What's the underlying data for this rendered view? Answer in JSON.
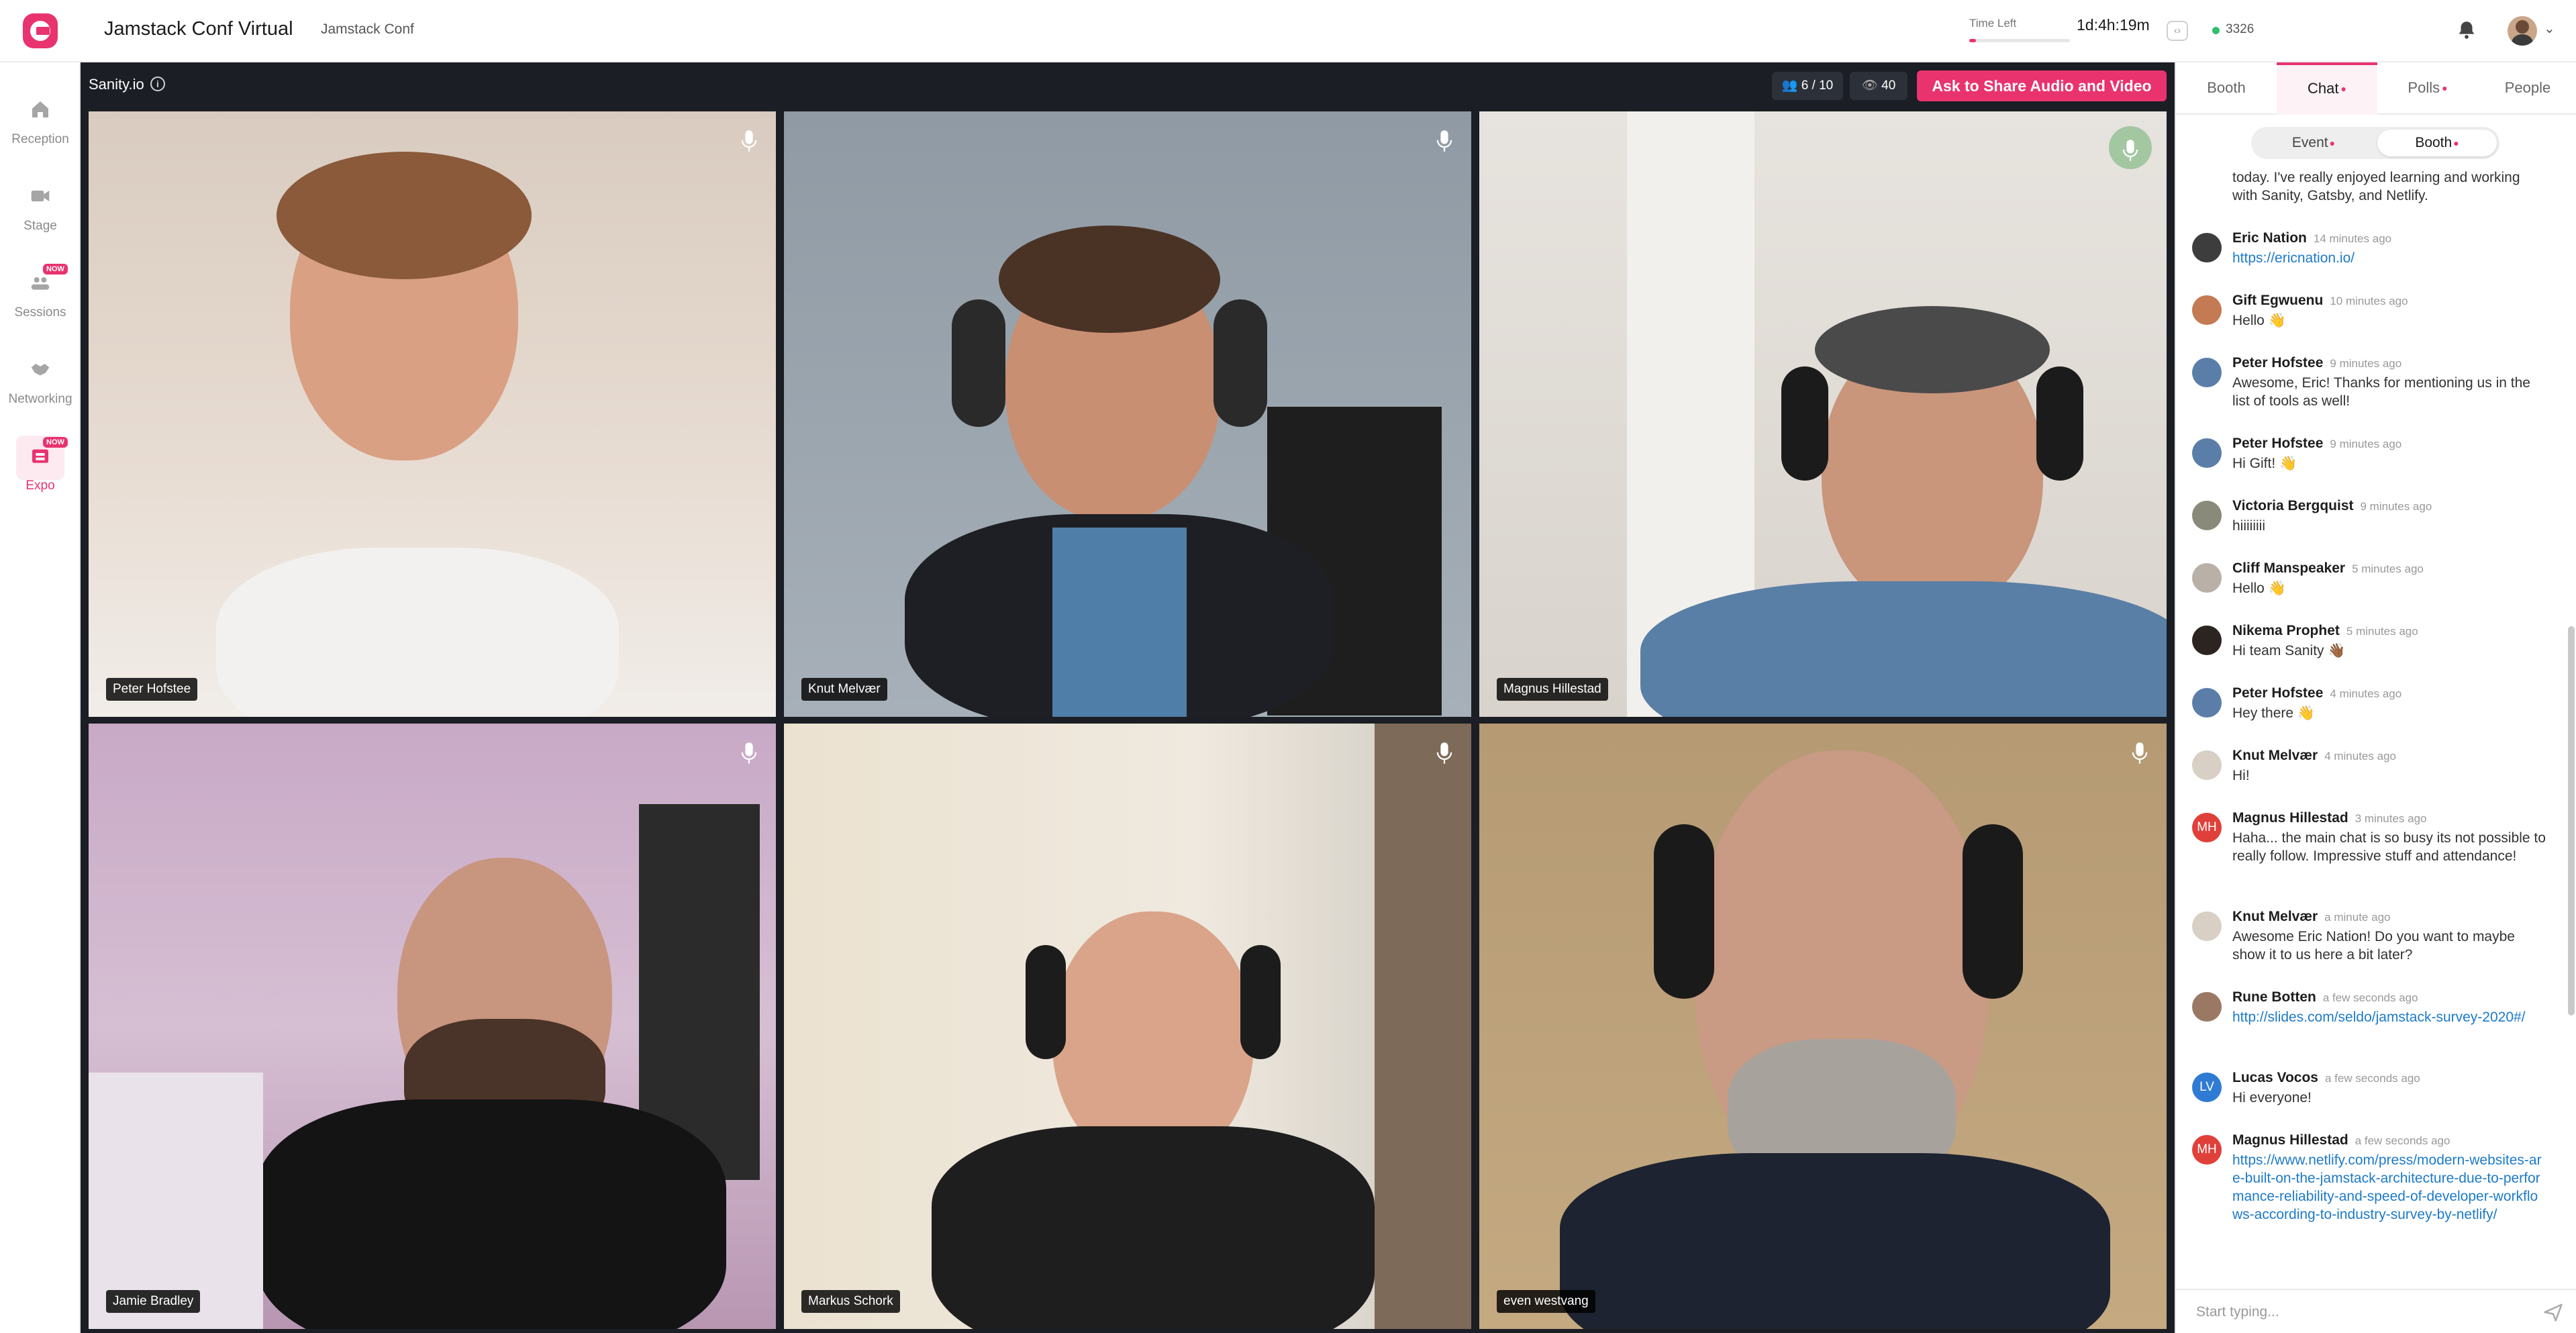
{
  "header": {
    "app_title": "Jamstack Conf Virtual",
    "org_name": "Jamstack Conf",
    "time_left_label": "Time Left",
    "time_left_value": "1d:4h:19m",
    "online_count": "3326"
  },
  "sidebar": {
    "items": [
      {
        "label": "Reception",
        "icon": "home-icon"
      },
      {
        "label": "Stage",
        "icon": "video-camera-icon"
      },
      {
        "label": "Sessions",
        "icon": "sessions-icon",
        "badge": "NOW"
      },
      {
        "label": "Networking",
        "icon": "handshake-icon"
      },
      {
        "label": "Expo",
        "icon": "expo-booth-icon",
        "badge": "NOW",
        "active": true
      }
    ]
  },
  "stage": {
    "booth_name": "Sanity.io",
    "participants": "6 / 10",
    "viewers": "40",
    "share_button": "Ask to Share Audio and Video",
    "tiles": [
      {
        "name": "Peter Hofstee"
      },
      {
        "name": "Knut Melvær"
      },
      {
        "name": "Magnus Hillestad",
        "speaking": true
      },
      {
        "name": "Jamie Bradley"
      },
      {
        "name": "Markus Schork"
      },
      {
        "name": "even westvang"
      }
    ]
  },
  "panel": {
    "tabs": [
      {
        "label": "Booth"
      },
      {
        "label": "Chat",
        "active": true,
        "dot": true
      },
      {
        "label": "Polls",
        "dot": true
      },
      {
        "label": "People"
      }
    ],
    "segments": [
      {
        "label": "Event",
        "dot": true
      },
      {
        "label": "Booth",
        "dot": true,
        "active": true
      }
    ],
    "messages": [
      {
        "author": "",
        "time": "",
        "text": "today. I've really enjoyed learning and working with Sanity, Gatsby, and Netlify."
      },
      {
        "author": "Eric Nation",
        "time": "14 minutes ago",
        "text": "https://ericnation.io/",
        "link": true
      },
      {
        "author": "Gift Egwuenu",
        "time": "10 minutes ago",
        "text": "Hello 👋"
      },
      {
        "author": "Peter Hofstee",
        "time": "9 minutes ago",
        "text": "Awesome, Eric! Thanks for mentioning us in the list of tools as well!"
      },
      {
        "author": "Peter Hofstee",
        "time": "9 minutes ago",
        "text": "Hi Gift! 👋"
      },
      {
        "author": "Victoria Bergquist",
        "time": "9 minutes ago",
        "text": "hiiiiiiii"
      },
      {
        "author": "Cliff Manspeaker",
        "time": "5 minutes ago",
        "text": "Hello 👋"
      },
      {
        "author": "Nikema Prophet",
        "time": "5 minutes ago",
        "text": "Hi team Sanity 👋🏾"
      },
      {
        "author": "Peter Hofstee",
        "time": "4 minutes ago",
        "text": "Hey there 👋"
      },
      {
        "author": "Knut Melvær",
        "time": "4 minutes ago",
        "text": "Hi!"
      },
      {
        "author": "Magnus Hillestad",
        "time": "3 minutes ago",
        "text": "Haha... the main chat is so busy its not possible to really follow. Impressive stuff and attendance!",
        "initials": "MH"
      },
      {
        "author": "Knut Melvær",
        "time": "a minute ago",
        "text": "Awesome Eric Nation! Do you want to maybe show it to us here a bit later?"
      },
      {
        "author": "Rune Botten",
        "time": "a few seconds ago",
        "text": "http://slides.com/seldo/jamstack-survey-2020#/",
        "link": true
      },
      {
        "author": "Lucas Vocos",
        "time": "a few seconds ago",
        "text": "Hi everyone!",
        "initials": "LV"
      },
      {
        "author": "Magnus Hillestad",
        "time": "a few seconds ago",
        "text": "https://www.netlify.com/press/modern-websites-are-built-on-the-jamstack-architecture-due-to-performance-reliability-and-speed-of-developer-workflows-according-to-industry-survey-by-netlify/",
        "link": true,
        "initials": "MH"
      }
    ],
    "input_placeholder": "Start typing..."
  },
  "colors": {
    "accent": "#e8336f",
    "stage_bg": "#1b1e24",
    "link": "#1d7ac9",
    "online": "#2fbf71"
  }
}
